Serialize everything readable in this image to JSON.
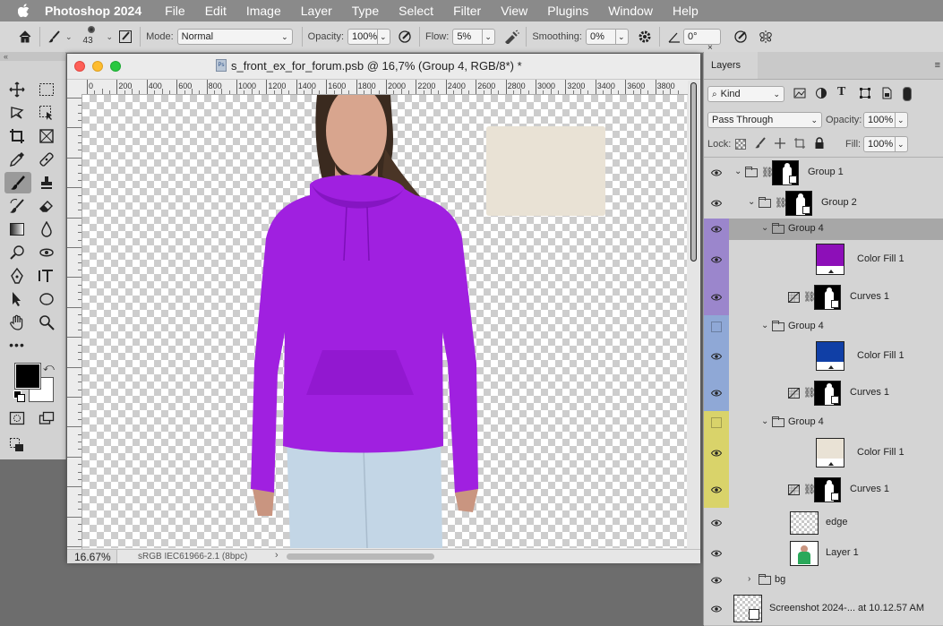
{
  "menubar": {
    "app_name": "Photoshop 2024",
    "items": [
      "File",
      "Edit",
      "Image",
      "Layer",
      "Type",
      "Select",
      "Filter",
      "View",
      "Plugins",
      "Window",
      "Help"
    ]
  },
  "options_bar": {
    "brush_size": "43",
    "mode_label": "Mode:",
    "mode_value": "Normal",
    "opacity_label": "Opacity:",
    "opacity_value": "100%",
    "flow_label": "Flow:",
    "flow_value": "5%",
    "smoothing_label": "Smoothing:",
    "smoothing_value": "0%",
    "angle_value": "0°"
  },
  "document": {
    "title": "s_front_ex_for_forum.psb @ 16,7% (Group 4, RGB/8*) *",
    "ruler_marks": [
      "0",
      "200",
      "400",
      "600",
      "800",
      "1000",
      "1200",
      "1400",
      "1600",
      "1800",
      "2000",
      "2200",
      "2400",
      "2600",
      "2800",
      "3000",
      "3200",
      "3400",
      "3600",
      "3800"
    ],
    "zoom": "16.67%",
    "color_profile": "sRGB IEC61966-2.1 (8bpc)",
    "swatch_color": "#e9e2d5",
    "hoodie_color": "#a020e0",
    "jeans_color": "#c3d6e6"
  },
  "layers_panel": {
    "tab_label": "Layers",
    "filter_kind": "Kind",
    "blend_mode": "Pass Through",
    "opacity_label": "Opacity:",
    "opacity_value": "100%",
    "lock_label": "Lock:",
    "fill_label": "Fill:",
    "fill_value": "100%",
    "layers": [
      {
        "name": "Group 1",
        "type": "group",
        "visible": true
      },
      {
        "name": "Group 2",
        "type": "group",
        "visible": true
      },
      {
        "name": "Group 4",
        "type": "group",
        "visible": true,
        "selected": true,
        "tag_color": "#9b86cc"
      },
      {
        "name": "Color Fill 1",
        "type": "fill",
        "visible": true,
        "fill_color": "#8d0fb8",
        "tag_color": "#9b86cc"
      },
      {
        "name": "Curves 1",
        "type": "adjustment",
        "visible": true,
        "tag_color": "#9b86cc"
      },
      {
        "name": "Group 4",
        "type": "group",
        "visible": false,
        "tag_color": "#8fa8d6"
      },
      {
        "name": "Color Fill 1",
        "type": "fill",
        "visible": true,
        "fill_color": "#103fa6",
        "tag_color": "#8fa8d6"
      },
      {
        "name": "Curves 1",
        "type": "adjustment",
        "visible": true,
        "tag_color": "#8fa8d6"
      },
      {
        "name": "Group 4",
        "type": "group",
        "visible": false,
        "tag_color": "#d9d36a"
      },
      {
        "name": "Color Fill 1",
        "type": "fill",
        "visible": true,
        "fill_color": "#e9e2d5",
        "tag_color": "#d9d36a"
      },
      {
        "name": "Curves 1",
        "type": "adjustment",
        "visible": true,
        "tag_color": "#d9d36a"
      },
      {
        "name": "edge",
        "type": "pixel",
        "visible": true
      },
      {
        "name": "Layer 1",
        "type": "pixel",
        "visible": true
      },
      {
        "name": "bg",
        "type": "group",
        "visible": true
      },
      {
        "name": "Screenshot 2024-... at 10.12.57 AM",
        "type": "smart",
        "visible": true
      }
    ]
  }
}
